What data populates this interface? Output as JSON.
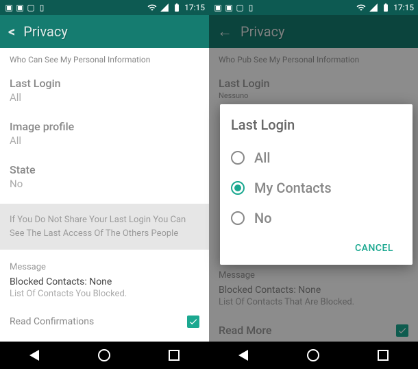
{
  "status": {
    "time": "17:15"
  },
  "left": {
    "title": "Privacy",
    "section_header": "Who Can See My Personal Information",
    "last_login_label": "Last Login",
    "last_login_value": "All",
    "image_label": "Image profile",
    "image_value": "All",
    "state_label": "State",
    "state_value": "No",
    "info_text": "If You Do Not Share Your Last Login You Can See The Last Access Of The Others People",
    "message_header": "Message",
    "blocked_line": "Blocked Contacts: None",
    "blocked_sub": "List Of Contacts You Blocked.",
    "read_confirm": "Read Confirmations"
  },
  "right": {
    "title": "Privacy",
    "section_header": "Who Pub See My Personal Information",
    "last_login_label": "Last Login",
    "last_login_value": "Nessuno",
    "message_header": "Message",
    "blocked_line": "Blocked Contacts: None",
    "blocked_sub": "List Of Contacts That Are Blocked.",
    "read_more": "Read More"
  },
  "dialog": {
    "title": "Last Login",
    "options": [
      "All",
      "My Contacts",
      "No"
    ],
    "selected": 1,
    "cancel": "CANCEL"
  }
}
